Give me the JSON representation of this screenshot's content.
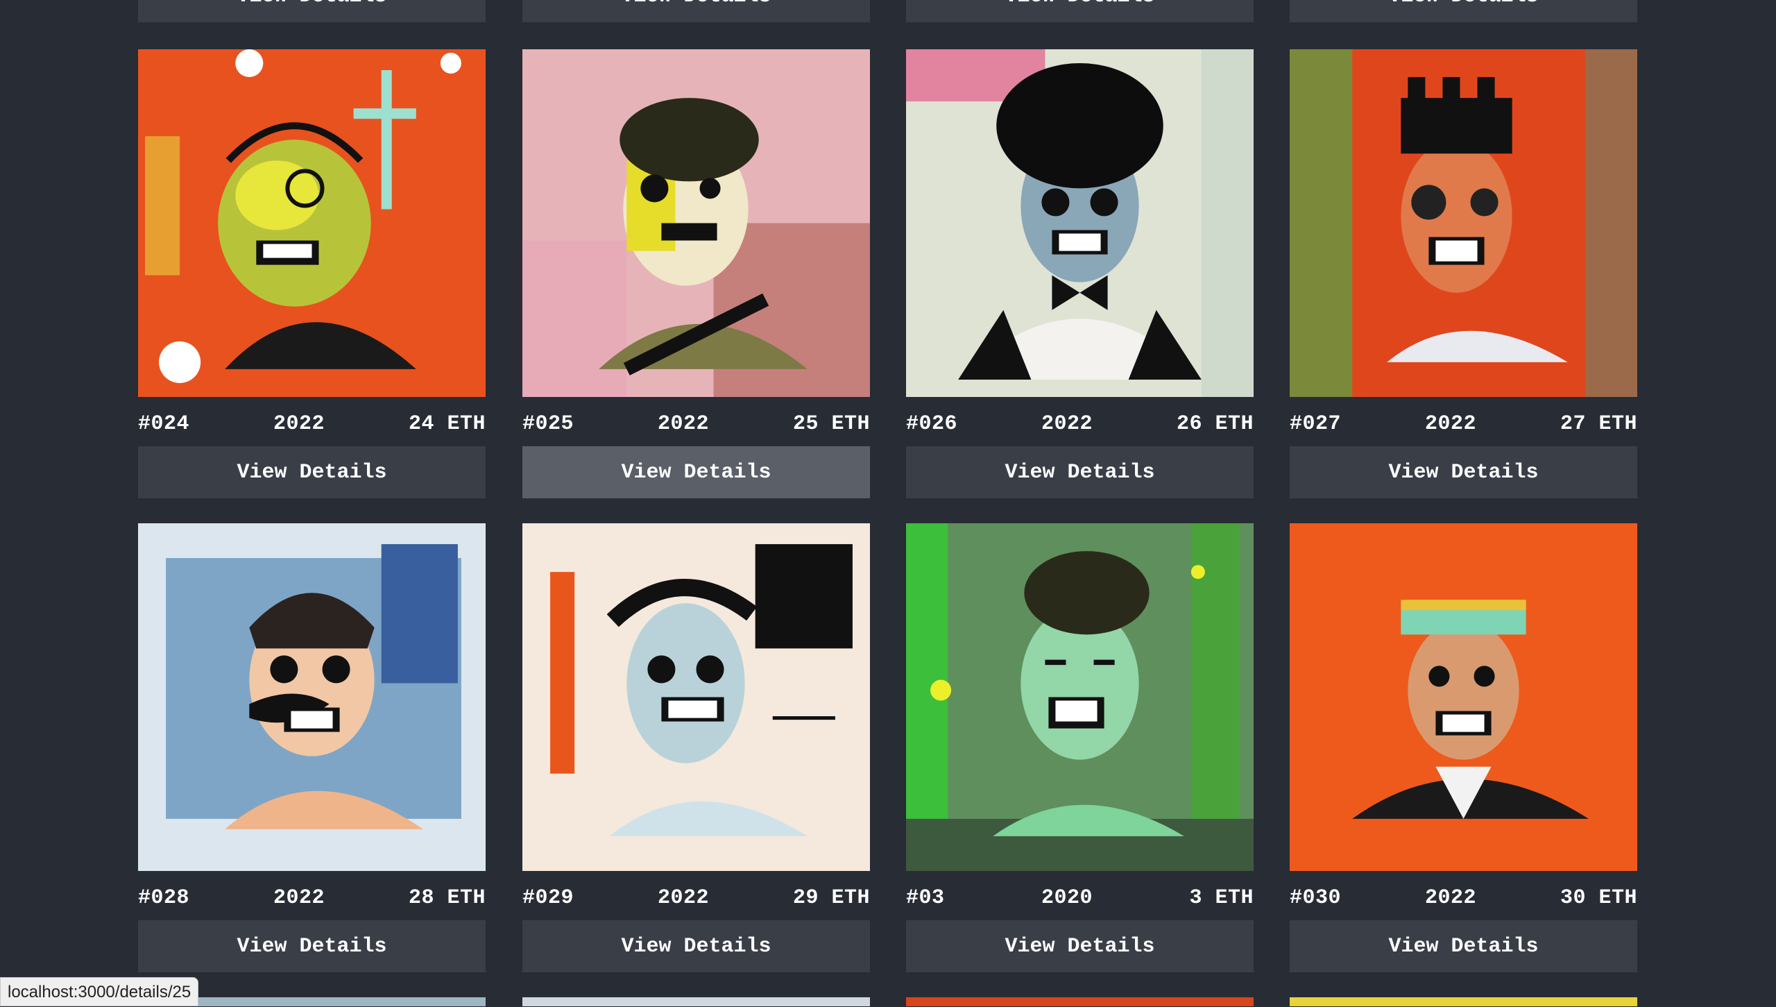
{
  "status_url": "localhost:3000/details/25",
  "top_row": {
    "button_label": "View Details"
  },
  "cards": [
    {
      "id": "#024",
      "year": "2022",
      "price": "24 ETH",
      "button": "View Details",
      "art": "skull-priest-orange",
      "bg": "#e8521f"
    },
    {
      "id": "#025",
      "year": "2022",
      "price": "25 ETH",
      "button": "View Details",
      "art": "skull-curly-pink",
      "bg": "#e6b4b8"
    },
    {
      "id": "#026",
      "year": "2022",
      "price": "26 ETH",
      "button": "View Details",
      "art": "skull-afro-bowtie",
      "bg": "#dfe3d4"
    },
    {
      "id": "#027",
      "year": "2022",
      "price": "27 ETH",
      "button": "View Details",
      "art": "skull-crown-red",
      "bg": "#e0461c"
    },
    {
      "id": "#028",
      "year": "2022",
      "price": "28 ETH",
      "button": "View Details",
      "art": "skull-mustache-blue",
      "bg": "#7ea6c8"
    },
    {
      "id": "#029",
      "year": "2022",
      "price": "29 ETH",
      "button": "View Details",
      "art": "skull-cream-sketch",
      "bg": "#f4e9dc"
    },
    {
      "id": "#03",
      "year": "2020",
      "price": "3 ETH",
      "button": "View Details",
      "art": "skull-green-forest",
      "bg": "#5f8f5c"
    },
    {
      "id": "#030",
      "year": "2022",
      "price": "30 ETH",
      "button": "View Details",
      "art": "skull-king-orange",
      "bg": "#ee5a1c"
    }
  ],
  "hovered_card_index": 1,
  "bottom_previews": [
    "#9fb5c2",
    "#cfd8de",
    "#d8441c",
    "#e6d43a"
  ]
}
